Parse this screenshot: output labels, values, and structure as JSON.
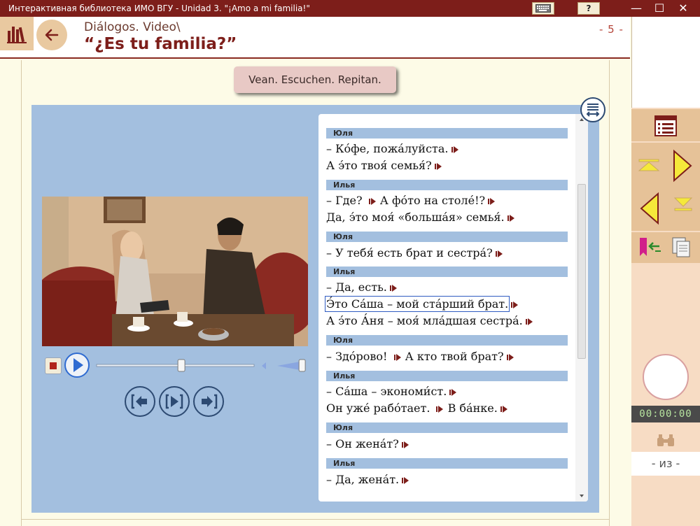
{
  "window": {
    "title": "Интерактивная библиотека ИМО ВГУ   -   Unidad 3. \"¡Amo a mi familia!\"",
    "help_label": "?",
    "minimize_glyph": "—",
    "maximize_glyph": "☐",
    "close_glyph": "✕"
  },
  "header": {
    "breadcrumb": "Diálogos. Video\\",
    "title": "“¿Es tu familia?”",
    "page_number": "- 5 -"
  },
  "instruction": "Vean. Escuchen. Repitan.",
  "player": {
    "position": 0.54,
    "volume": 0.95
  },
  "transcript": [
    {
      "speaker": "Юля",
      "lines": [
        "– Ко́фе, пожа́луйста.",
        "А э́то твоя́ семья́?"
      ]
    },
    {
      "speaker": "Илья",
      "lines": [
        "– Где? ",
        "Да, э́то моя́ «больша́я» семья́."
      ],
      "extra": "А фо́то на столе́!?"
    },
    {
      "speaker": "Юля",
      "lines": [
        "– У тебя́ есть брат и сестра́?"
      ]
    },
    {
      "speaker": "Илья",
      "lines": [
        "– Да, есть.",
        "Э́то Са́ша – мой ста́рший брат.",
        "А э́то А́ня – моя́ мла́дшая сестра́."
      ]
    },
    {
      "speaker": "Юля",
      "lines": [
        "– Здо́рово! "
      ],
      "extra": "А кто твой брат?"
    },
    {
      "speaker": "Илья",
      "lines": [
        "– Са́ша – экономи́ст.",
        "Он уже́ рабо́тает. "
      ],
      "extra": "В ба́нке."
    },
    {
      "speaker": "Юля",
      "lines": [
        "– Он жена́т?"
      ]
    },
    {
      "speaker": "Илья",
      "lines": [
        "– Да, жена́т."
      ]
    }
  ],
  "sidebar": {
    "timer": "00:00:00",
    "page_of": "- из -"
  },
  "colors": {
    "brand": "#7d1e1a",
    "stage": "#a3bfdf",
    "accent_yellow": "#f5e93a",
    "panel": "#f7dcc4"
  }
}
